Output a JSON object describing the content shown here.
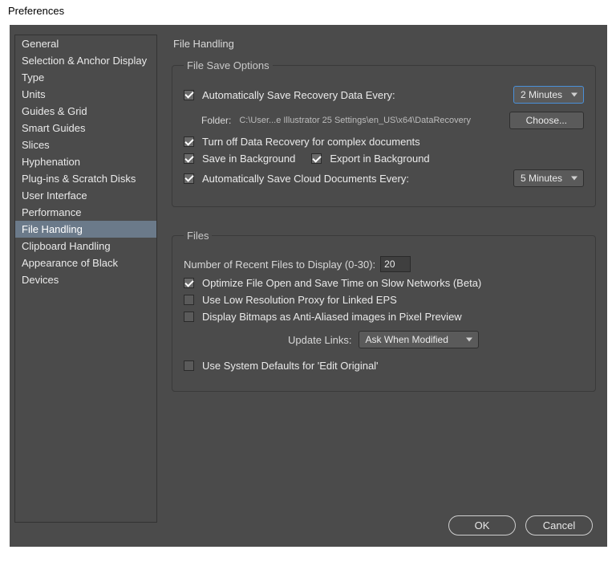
{
  "window": {
    "title": "Preferences"
  },
  "sidebar": {
    "items": [
      "General",
      "Selection & Anchor Display",
      "Type",
      "Units",
      "Guides & Grid",
      "Smart Guides",
      "Slices",
      "Hyphenation",
      "Plug-ins & Scratch Disks",
      "User Interface",
      "Performance",
      "File Handling",
      "Clipboard Handling",
      "Appearance of Black",
      "Devices"
    ],
    "active_index": 11
  },
  "page": {
    "title": "File Handling"
  },
  "save": {
    "legend": "File Save Options",
    "auto_recovery_label": "Automatically Save Recovery Data Every:",
    "auto_recovery_checked": true,
    "recovery_interval": "2 Minutes",
    "folder_prefix": "Folder:",
    "folder_path": "C:\\User...e Illustrator 25 Settings\\en_US\\x64\\DataRecovery",
    "choose_label": "Choose...",
    "turn_off_label": "Turn off Data Recovery for complex documents",
    "turn_off_checked": true,
    "save_bg_label": "Save in Background",
    "save_bg_checked": true,
    "export_bg_label": "Export in Background",
    "export_bg_checked": true,
    "cloud_label": "Automatically Save Cloud Documents Every:",
    "cloud_checked": true,
    "cloud_interval": "5 Minutes"
  },
  "files": {
    "legend": "Files",
    "recent_label": "Number of Recent Files to Display (0-30):",
    "recent_value": "20",
    "optimize_label": "Optimize File Open and Save Time on Slow Networks (Beta)",
    "optimize_checked": true,
    "lowres_label": "Use Low Resolution Proxy for Linked EPS",
    "lowres_checked": false,
    "bitmap_label": "Display Bitmaps as Anti-Aliased images in Pixel Preview",
    "bitmap_checked": false,
    "update_links_label": "Update Links:",
    "update_links_value": "Ask When Modified",
    "sysdefault_label": "Use System Defaults for 'Edit Original'",
    "sysdefault_checked": false
  },
  "footer": {
    "ok": "OK",
    "cancel": "Cancel"
  }
}
